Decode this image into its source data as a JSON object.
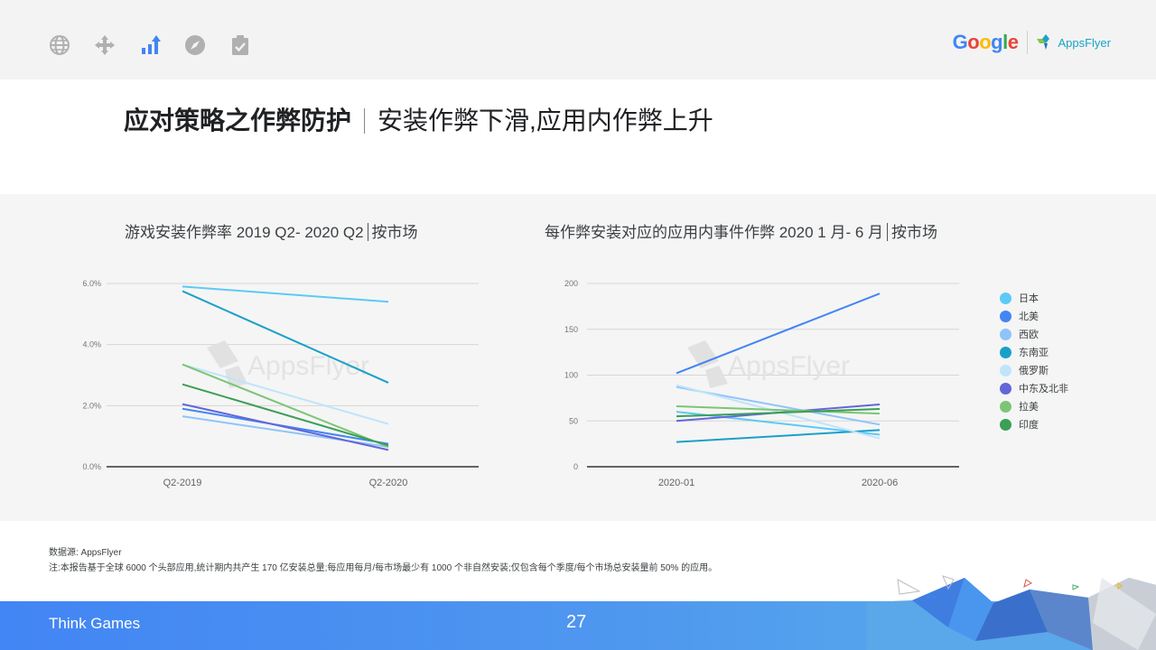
{
  "nav": {
    "icons": [
      "globe-icon",
      "move-arrows-icon",
      "trending-bars-icon",
      "compass-icon",
      "clipboard-check-icon"
    ],
    "active_index": 2,
    "active_color": "#4285f4",
    "inactive_color": "#b0b0b0"
  },
  "logos": {
    "google": "Google",
    "appsflyer": "AppsFlyer"
  },
  "header": {
    "title_bold": "应对策略之作弊防护",
    "title_rest": "安装作弊下滑,应用内作弊上升"
  },
  "chart_data": [
    {
      "type": "line",
      "title": "游戏安装作弊率 2019 Q2- 2020 Q2",
      "title_suffix": "按市场",
      "x": [
        "Q2-2019",
        "Q2-2020"
      ],
      "xlabel": "",
      "ylabel": "",
      "ylim": [
        0,
        6
      ],
      "yticks": [
        "0.0%",
        "2.0%",
        "4.0%",
        "6.0%"
      ],
      "ytick_values": [
        0,
        2,
        4,
        6
      ],
      "unit": "%",
      "grid": true,
      "watermark": "AppsFlyer",
      "series": [
        {
          "name": "日本",
          "color": "#5ccaf6",
          "values": [
            5.9,
            5.4
          ]
        },
        {
          "name": "北美",
          "color": "#4285f4",
          "values": [
            1.9,
            0.75
          ]
        },
        {
          "name": "西欧",
          "color": "#8ec4fb",
          "values": [
            1.65,
            0.65
          ]
        },
        {
          "name": "东南亚",
          "color": "#1aa0c8",
          "values": [
            5.75,
            2.75
          ]
        },
        {
          "name": "俄罗斯",
          "color": "#bfe4fb",
          "values": [
            3.35,
            1.4
          ]
        },
        {
          "name": "中东及北非",
          "color": "#6366d8",
          "values": [
            2.05,
            0.55
          ]
        },
        {
          "name": "拉美",
          "color": "#7cc576",
          "values": [
            3.35,
            0.65
          ]
        },
        {
          "name": "印度",
          "color": "#3b9f55",
          "values": [
            2.7,
            0.7
          ]
        }
      ]
    },
    {
      "type": "line",
      "title": "每作弊安装对应的应用内事件作弊 2020 1 月- 6 月",
      "title_suffix": "按市场",
      "x": [
        "2020-01",
        "2020-06"
      ],
      "xlabel": "",
      "ylabel": "",
      "ylim": [
        0,
        200
      ],
      "yticks": [
        "0",
        "50",
        "100",
        "150",
        "200"
      ],
      "ytick_values": [
        0,
        50,
        100,
        150,
        200
      ],
      "grid": true,
      "watermark": "AppsFlyer",
      "legend_position": "right",
      "series": [
        {
          "name": "日本",
          "color": "#5ccaf6",
          "values": [
            60,
            35
          ]
        },
        {
          "name": "北美",
          "color": "#4285f4",
          "values": [
            102,
            189
          ]
        },
        {
          "name": "西欧",
          "color": "#8ec4fb",
          "values": [
            87,
            46
          ]
        },
        {
          "name": "东南亚",
          "color": "#1aa0c8",
          "values": [
            27,
            40
          ]
        },
        {
          "name": "俄罗斯",
          "color": "#bfe4fb",
          "values": [
            89,
            31
          ]
        },
        {
          "name": "中东及北非",
          "color": "#6366d8",
          "values": [
            50,
            68
          ]
        },
        {
          "name": "拉美",
          "color": "#7cc576",
          "values": [
            66,
            58
          ]
        },
        {
          "name": "印度",
          "color": "#3b9f55",
          "values": [
            55,
            63
          ]
        }
      ]
    }
  ],
  "notes": {
    "source": "数据源: AppsFlyer",
    "note": "注:本报告基于全球 6000 个头部应用,统计期内共产生 170 亿安装总量;每应用每月/每市场最少有 1000 个非自然安装;仅包含每个季度/每个市场总安装量前 50% 的应用。"
  },
  "footer": {
    "brand": "Think Games",
    "page_number": "27"
  }
}
